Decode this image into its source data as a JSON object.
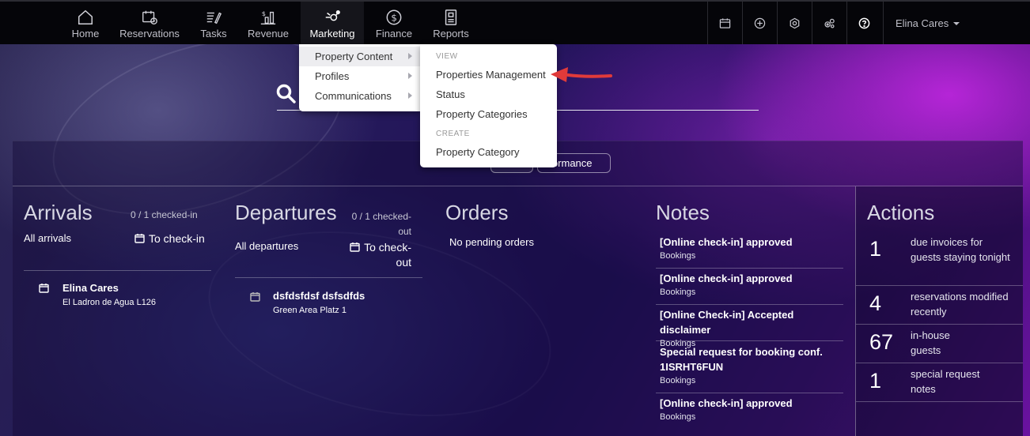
{
  "nav": {
    "items": [
      {
        "label": "Home",
        "icon": "home-icon"
      },
      {
        "label": "Reservations",
        "icon": "calendar-clock-icon"
      },
      {
        "label": "Tasks",
        "icon": "task-list-icon"
      },
      {
        "label": "Revenue",
        "icon": "revenue-chart-icon"
      },
      {
        "label": "Marketing",
        "icon": "marketing-icon",
        "active": true
      },
      {
        "label": "Finance",
        "icon": "dollar-icon"
      },
      {
        "label": "Reports",
        "icon": "report-icon"
      }
    ],
    "right_icons": [
      "calendar-icon",
      "add-circle-icon",
      "settings-icon",
      "gears-icon",
      "help-icon"
    ],
    "user_name": "Elina Cares"
  },
  "dropdown": {
    "left_items": [
      {
        "label": "Property Content",
        "hover": true
      },
      {
        "label": "Profiles"
      },
      {
        "label": "Communications"
      }
    ],
    "view_header": "VIEW",
    "view_items": [
      "Properties Management",
      "Status",
      "Property Categories"
    ],
    "create_header": "CREATE",
    "create_items": [
      "Property Category"
    ]
  },
  "filters": {
    "performance_label": "rformance"
  },
  "arrivals": {
    "title": "Arrivals",
    "count": "0 / 1 checked-in",
    "filter_label": "All arrivals",
    "action_label": "To check-in",
    "guest_name": "Elina Cares",
    "guest_location": "El Ladron de Agua L126"
  },
  "departures": {
    "title": "Departures",
    "count_line1": "0 / 1 checked-",
    "count_line2": "out",
    "filter_label": "All departures",
    "action_line1": "To check-",
    "action_line2": "out",
    "guest_name": "dsfdsfdsf dsfsdfds",
    "guest_location": "Green Area Platz 1"
  },
  "orders": {
    "title": "Orders",
    "empty_text": "No pending orders"
  },
  "notes": {
    "title": "Notes",
    "items": [
      {
        "title": "[Online check-in] approved",
        "category": "Bookings"
      },
      {
        "title": "[Online check-in] approved",
        "category": "Bookings"
      },
      {
        "title": "[Online Check-in] Accepted disclaimer",
        "category": "Bookings"
      },
      {
        "title": "Special request for booking conf. 1ISRHT6FUN",
        "category": "Bookings"
      },
      {
        "title": "[Online check-in] approved",
        "category": "Bookings"
      }
    ]
  },
  "actions": {
    "title": "Actions",
    "items": [
      {
        "count": "1",
        "label": "due invoices for guests staying tonight"
      },
      {
        "count": "4",
        "label": "reservations modified recently"
      },
      {
        "count": "67",
        "label": "in-house guests"
      },
      {
        "count": "1",
        "label": "special request notes"
      }
    ]
  },
  "colors": {
    "nav_bg": "#050509",
    "accent_arrow": "#e03a3a",
    "bg_purple": "#6a12a0"
  }
}
